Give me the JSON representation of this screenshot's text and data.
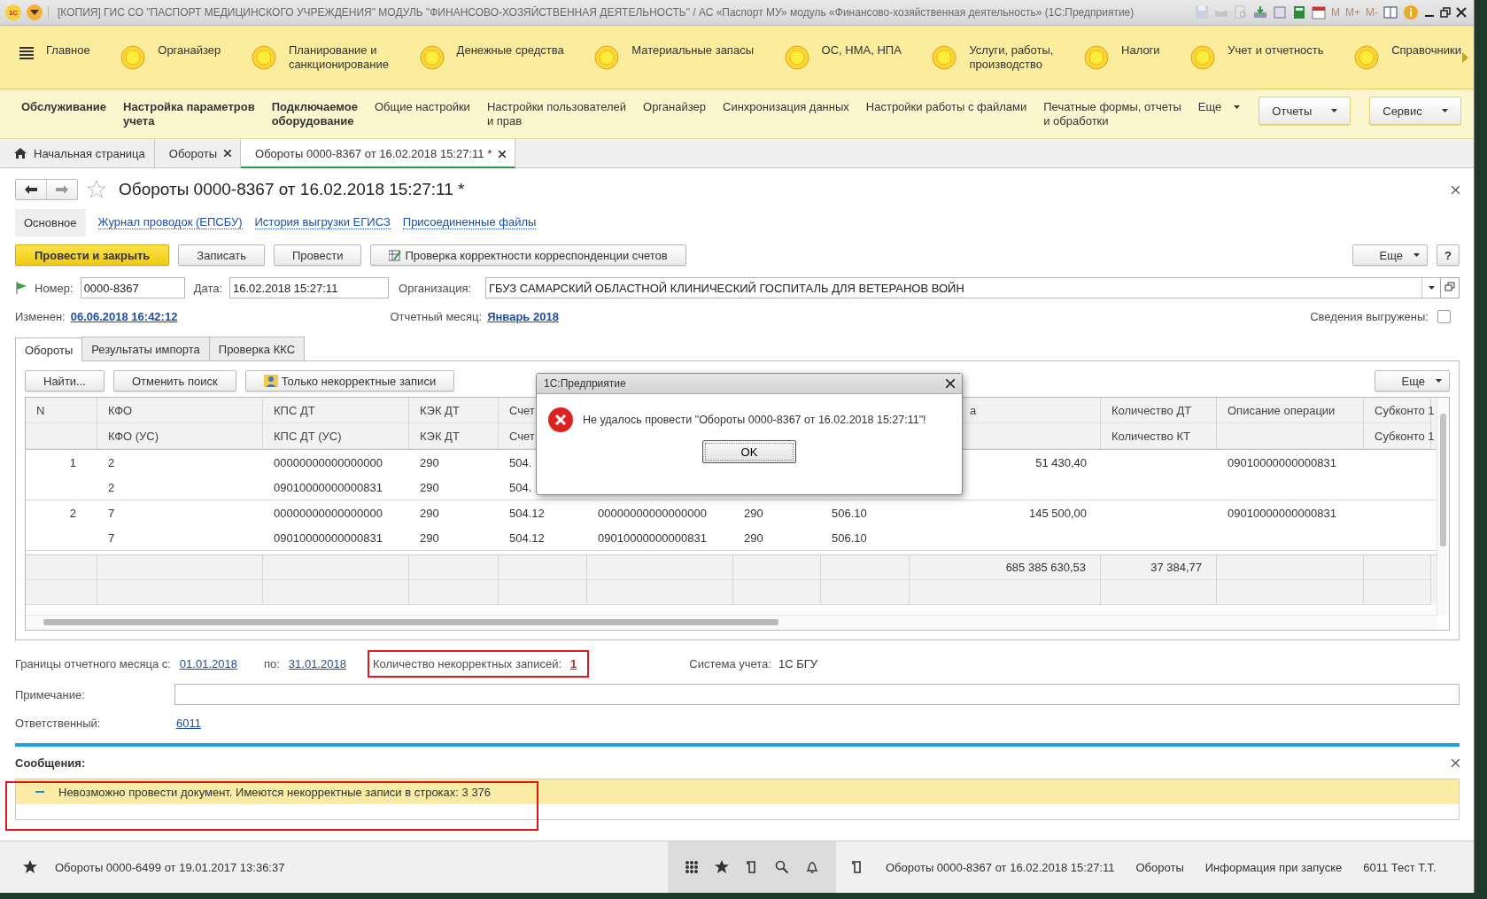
{
  "window": {
    "logo": "1С",
    "title": "[КОПИЯ] ГИС СО \"ПАСПОРТ МЕДИЦИНСКОГО УЧРЕЖДЕНИЯ\" МОДУЛЬ \"ФИНАНСОВО-ХОЗЯЙСТВЕННАЯ ДЕЯТЕЛЬНОСТЬ\" / АС «Паспорт МУ» модуль «Финансово-хозяйственная деятельность»  (1С:Предприятие)",
    "memory_keys": [
      {
        "label": "M",
        "disabled": true
      },
      {
        "label": "M+",
        "disabled": true
      },
      {
        "label": "M-",
        "disabled": true
      }
    ]
  },
  "sections": [
    {
      "label": "Главное",
      "kind": "menu"
    },
    {
      "label": "Органайзер",
      "kind": "section"
    },
    {
      "label": "Планирование и\nсанкционирование",
      "kind": "section"
    },
    {
      "label": "Денежные средства",
      "kind": "section"
    },
    {
      "label": "Материальные запасы",
      "kind": "section"
    },
    {
      "label": "ОС, НМА, НПА",
      "kind": "section"
    },
    {
      "label": "Услуги, работы,\nпроизводство",
      "kind": "section"
    },
    {
      "label": "Налоги",
      "kind": "section"
    },
    {
      "label": "Учет и отчетность",
      "kind": "section"
    },
    {
      "label": "Справочники",
      "kind": "section"
    }
  ],
  "commands": [
    {
      "label": "Обслуживание",
      "kind": "bold"
    },
    {
      "label": "Настройка параметров\nучета",
      "kind": "bold"
    },
    {
      "label": "Подключаемое\nоборудование",
      "kind": "bold"
    },
    {
      "label": "Общие настройки",
      "kind": "link"
    },
    {
      "label": "Настройки пользователей\nи прав",
      "kind": "link"
    },
    {
      "label": "Органайзер",
      "kind": "link"
    },
    {
      "label": "Синхронизация данных",
      "kind": "link"
    },
    {
      "label": "Настройки работы с файлами",
      "kind": "link"
    },
    {
      "label": "Печатные формы, отчеты\nи обработки",
      "kind": "link"
    },
    {
      "label": "Еще",
      "kind": "more"
    },
    {
      "label": "Отчеты",
      "kind": "button"
    },
    {
      "label": "Сервис",
      "kind": "button"
    }
  ],
  "open_tabs": [
    {
      "label": "Начальная страница",
      "kind": "home",
      "selected": false
    },
    {
      "label": "Обороты",
      "kind": "doc",
      "selected": false
    },
    {
      "label": "Обороты 0000-8367 от 16.02.2018 15:27:11 *",
      "kind": "doc",
      "selected": true
    }
  ],
  "form": {
    "title": "Обороты 0000-8367 от 16.02.2018 15:27:11 *",
    "nav": [
      {
        "label": "Основное",
        "selected": true
      },
      {
        "label": "Журнал проводок (ЕПСБУ)",
        "selected": false
      },
      {
        "label": "История выгрузки ЕГИСЗ",
        "selected": false
      },
      {
        "label": "Присоединенные файлы",
        "selected": false
      }
    ],
    "buttons": [
      {
        "label": "Провести и закрыть",
        "kind": "primary"
      },
      {
        "label": "Записать",
        "kind": "plain"
      },
      {
        "label": "Провести",
        "kind": "plain"
      },
      {
        "label": "Проверка корректности корреспонденции счетов",
        "kind": "icon"
      }
    ],
    "more": "Еще",
    "help": "?",
    "number_label": "Номер:",
    "number": "0000-8367",
    "date_label": "Дата:",
    "date": "16.02.2018 15:27:11",
    "org_label": "Организация:",
    "org": "ГБУЗ САМАРСКИЙ ОБЛАСТНОЙ КЛИНИЧЕСКИЙ ГОСПИТАЛЬ ДЛЯ ВЕТЕРАНОВ ВОЙН",
    "changed_label": "Изменен:",
    "changed": "06.06.2018 16:42:12",
    "month_label": "Отчетный месяц:",
    "month": "Январь 2018",
    "exported_label": "Сведения выгружены:",
    "exported": false,
    "tabs": [
      {
        "label": "Обороты",
        "selected": true
      },
      {
        "label": "Результаты импорта",
        "selected": false
      },
      {
        "label": "Проверка ККС",
        "selected": false
      }
    ],
    "table_buttons": [
      {
        "label": "Найти...",
        "kind": "plain"
      },
      {
        "label": "Отменить поиск",
        "kind": "plain"
      },
      {
        "label": "Только некорректные записи",
        "kind": "icon"
      }
    ],
    "table_more": "Еще"
  },
  "table": {
    "columns": [
      {
        "kind": "shown",
        "top": "N"
      },
      {
        "kind": "shown",
        "top": "КФО",
        "bottom": "КФО (УС)"
      },
      {
        "kind": "shown",
        "top": "КПС ДТ",
        "bottom": "КПС ДТ (УС)"
      },
      {
        "kind": "shown",
        "top": "КЭК ДТ",
        "bottom": "КЭК ДТ"
      },
      {
        "kind": "shown",
        "top": "Счет",
        "bottom": "Счет"
      },
      {
        "kind": "covered"
      },
      {
        "kind": "covered"
      },
      {
        "kind": "covered"
      },
      {
        "kind": "tail",
        "top": "а"
      },
      {
        "kind": "shown",
        "top": "Количество ДТ",
        "bottom": "Количество КТ"
      },
      {
        "kind": "shown",
        "top": "Описание операции"
      },
      {
        "kind": "shown",
        "top": "Субконто 1",
        "bottom": "Субконто 1"
      }
    ],
    "rows": [
      {
        "n": "1",
        "lines": [
          {
            "kfo": "2",
            "kps_dt": "00000000000000000",
            "kek_dt": "290",
            "account_dt": "504.",
            "column_9": "51 430,40",
            "description": "09010000000000831"
          },
          {
            "kfo": "2",
            "kps_dt": "09010000000000831",
            "kek_dt": "290",
            "account_dt": "504."
          }
        ]
      },
      {
        "n": "2",
        "lines": [
          {
            "kfo": "7",
            "kps_dt": "00000000000000000",
            "kek_dt": "290",
            "account_dt": "504.12",
            "column_6": "00000000000000000",
            "column_7": "290",
            "column_8": "506.10",
            "column_9": "145 500,00",
            "description": "09010000000000831"
          },
          {
            "kfo": "7",
            "kps_dt": "09010000000000831",
            "kek_dt": "290",
            "account_dt": "504.12",
            "column_6": "09010000000000831",
            "column_7": "290",
            "column_8": "506.10"
          }
        ]
      }
    ],
    "totals": {
      "column_9": "685 385 630,53",
      "quantity": "37 384,77"
    }
  },
  "dialog": {
    "title": "1С:Предприятие",
    "message": "Не удалось провести \"Обороты 0000-8367 от 16.02.2018 15:27:11\"!",
    "button": "OK"
  },
  "footer": {
    "period_label": "Границы отчетного месяца с:",
    "period_from": "01.01.2018",
    "to_label": "по:",
    "period_to": "31.01.2018",
    "errors_label": "Количество некорректных записей:",
    "errors": "1",
    "errors_annotated": true,
    "system_label": "Система учета:",
    "system": "1С БГУ",
    "note_label": "Примечание:",
    "owner_label": "Ответственный:",
    "owner": "6011"
  },
  "messages": {
    "title": "Сообщения:",
    "annotated": true,
    "items": [
      {
        "text": "Невозможно провести документ. Имеются некорректные записи в строках: 3 376",
        "expanded": true
      }
    ]
  },
  "status_bar": {
    "history": "Обороты 0000-6499 от 19.01.2017 13:36:37",
    "current": "Обороты 0000-8367 от 16.02.2018 15:27:11",
    "links": [
      "Обороты",
      "Информация при запуске",
      "6011 Тест Т.Т."
    ]
  }
}
